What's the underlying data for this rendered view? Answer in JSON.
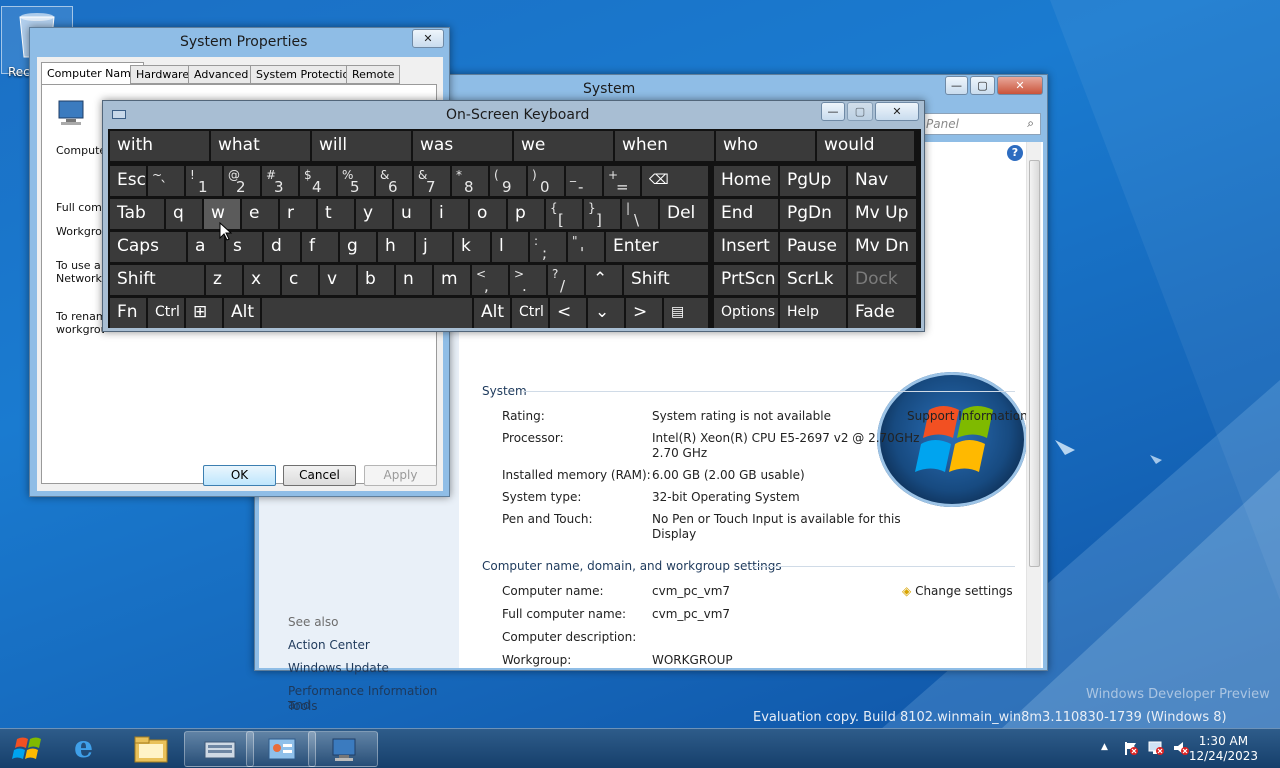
{
  "desktop": {
    "recycle_label": "Rec",
    "watermark_line1": "Windows Developer Preview",
    "watermark_line2": "Evaluation copy. Build 8102.winmain_win8m3.110830-1739 (Windows 8)"
  },
  "system_window": {
    "title": "System",
    "search_placeholder": "Panel",
    "see_also": "See also",
    "see_also_links": [
      "Action Center",
      "Windows Update",
      "Performance Information and",
      "Tools"
    ],
    "system_section": "System",
    "rows": [
      {
        "label": "Rating:",
        "value": "System rating is not available"
      },
      {
        "label": "Processor:",
        "value": "Intel(R) Xeon(R) CPU E5-2697 v2 @ 2.70GHz",
        "value2": "2.70 GHz"
      },
      {
        "label": "Installed memory (RAM):",
        "value": "6.00 GB (2.00 GB usable)"
      },
      {
        "label": "System type:",
        "value": "32-bit Operating System"
      },
      {
        "label": "Pen and Touch:",
        "value": "No Pen or Touch Input is available for this",
        "value2": "Display"
      }
    ],
    "support_info": "Support Information",
    "computer_section": "Computer name, domain, and workgroup settings",
    "computer_rows": [
      {
        "label": "Computer name:",
        "value": "cvm_pc_vm7"
      },
      {
        "label": "Full computer name:",
        "value": "cvm_pc_vm7"
      },
      {
        "label": "Computer description:",
        "value": ""
      },
      {
        "label": "Workgroup:",
        "value": "WORKGROUP"
      }
    ],
    "change_settings": "Change settings",
    "help_icon": "?"
  },
  "system_properties": {
    "title": "System Properties",
    "tabs": [
      "Computer Name",
      "Hardware",
      "Advanced",
      "System Protection",
      "Remote"
    ],
    "text_computer": "Computer",
    "text_full": "Full compu",
    "text_workgroup": "Workgrou",
    "text_use1": "To use a w",
    "text_use2": "Network I",
    "text_rename1": "To renam",
    "text_rename2": "workgroup",
    "ok": "OK",
    "cancel": "Cancel",
    "apply": "Apply"
  },
  "osk": {
    "title": "On-Screen Keyboard",
    "predictions": [
      "with",
      "what",
      "will",
      "was",
      "we",
      "when",
      "who",
      "would"
    ],
    "row1": {
      "esc": "Esc",
      "keys": [
        {
          "top": "~",
          "bot": "`"
        },
        {
          "top": "!",
          "bot": "1"
        },
        {
          "top": "@",
          "bot": "2"
        },
        {
          "top": "#",
          "bot": "3"
        },
        {
          "top": "$",
          "bot": "4"
        },
        {
          "top": "%",
          "bot": "5"
        },
        {
          "top": "&",
          "bot": "6"
        },
        {
          "top": "&",
          "bot": "7"
        },
        {
          "top": "*",
          "bot": "8"
        },
        {
          "top": "(",
          "bot": "9"
        },
        {
          "top": ")",
          "bot": "0"
        },
        {
          "top": "_",
          "bot": "-"
        },
        {
          "top": "+",
          "bot": "="
        }
      ],
      "backspace": "⌫"
    },
    "row2": {
      "tab": "Tab",
      "letters": [
        "q",
        "w",
        "e",
        "r",
        "t",
        "y",
        "u",
        "i",
        "o",
        "p"
      ],
      "brackets": [
        {
          "top": "{",
          "bot": "["
        },
        {
          "top": "}",
          "bot": "]"
        },
        {
          "top": "|",
          "bot": "\\"
        }
      ],
      "del": "Del"
    },
    "row3": {
      "caps": "Caps",
      "letters": [
        "a",
        "s",
        "d",
        "f",
        "g",
        "h",
        "j",
        "k",
        "l"
      ],
      "punct": [
        {
          "top": ":",
          "bot": ";"
        },
        {
          "top": "\"",
          "bot": "'"
        }
      ],
      "enter": "Enter"
    },
    "row4": {
      "shift": "Shift",
      "letters": [
        "z",
        "x",
        "c",
        "v",
        "b",
        "n",
        "m"
      ],
      "punct": [
        {
          "top": "<",
          "bot": ","
        },
        {
          "top": ">",
          "bot": "."
        },
        {
          "top": "?",
          "bot": "/"
        }
      ],
      "up": "⌃",
      "shift_right": "Shift"
    },
    "row5": {
      "fn": "Fn",
      "ctrl": "Ctrl",
      "win": "⊞",
      "alt": "Alt",
      "alt_right": "Alt",
      "ctrl_right": "Ctrl",
      "left": "<",
      "down": "⌄",
      "right": ">",
      "menu": "▤"
    },
    "nav": [
      [
        "Home",
        "PgUp",
        "Nav"
      ],
      [
        "End",
        "PgDn",
        "Mv Up"
      ],
      [
        "Insert",
        "Pause",
        "Mv Dn"
      ],
      [
        "PrtScn",
        "ScrLk",
        "Dock"
      ],
      [
        "Options",
        "Help",
        "Fade"
      ]
    ]
  },
  "taskbar": {
    "time": "1:30 AM",
    "date": "12/24/2023",
    "tray_arrow": "▲"
  },
  "colors": {
    "accent": "#0066cc",
    "osk_key": "#3a3a3a",
    "osk_bg": "#121212"
  }
}
